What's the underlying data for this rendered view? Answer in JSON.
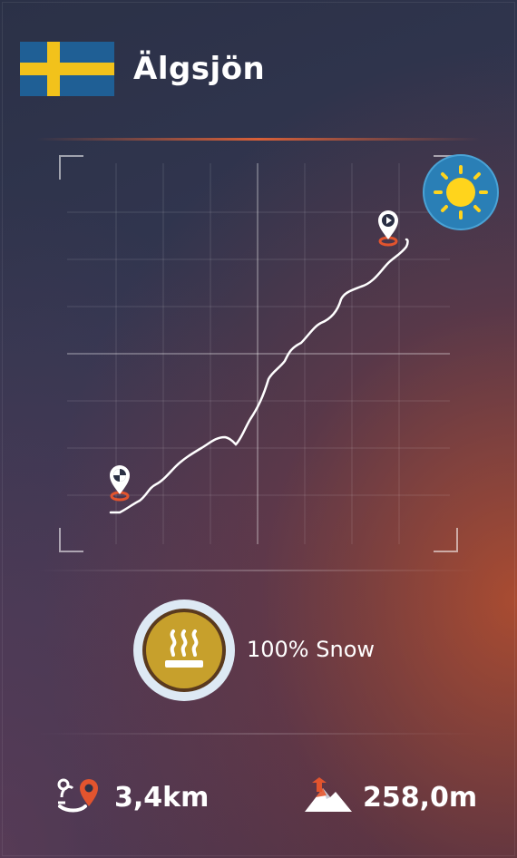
{
  "header": {
    "flag": "sweden-flag",
    "title": "Älgsjön"
  },
  "weather": {
    "icon": "sun-icon"
  },
  "map": {
    "start_marker": "checkered-flag-pin-icon",
    "finish_marker": "play-pin-icon"
  },
  "snow": {
    "icon": "heated-surface-icon",
    "label": "100% Snow"
  },
  "stats": {
    "distance": {
      "icon": "route-distance-icon",
      "value": "3,4km"
    },
    "elevation": {
      "icon": "elevation-gain-icon",
      "value": "258,0m"
    }
  },
  "colors": {
    "accent_orange": "#e2542e",
    "sun_blue": "#2a7fb6",
    "sun_yellow": "#ffd41c",
    "badge_gold": "#c7a02c",
    "flag_blue": "#1f5f95",
    "flag_yellow": "#f2c21b"
  }
}
